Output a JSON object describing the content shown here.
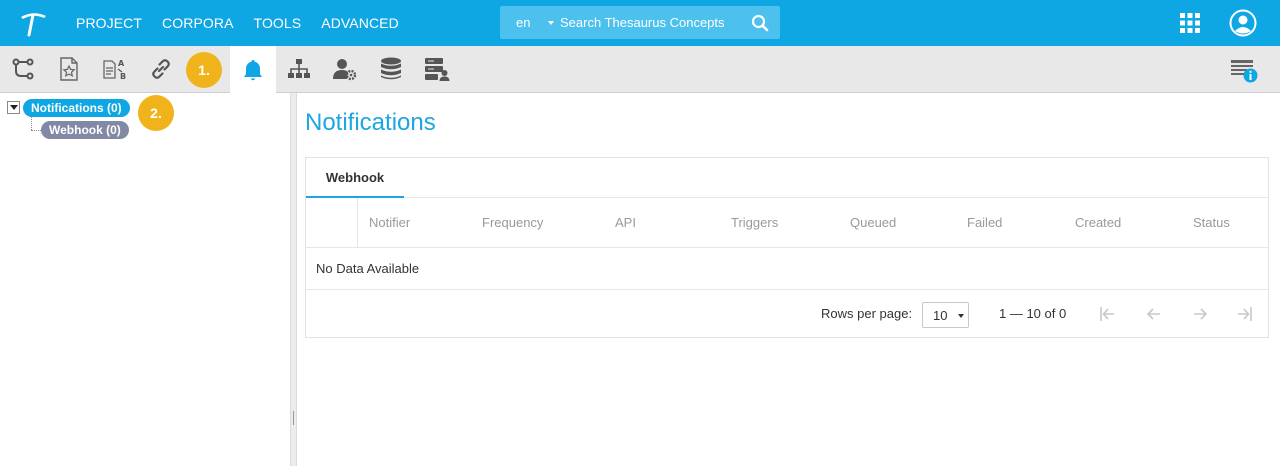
{
  "topbar": {
    "nav": [
      "PROJECT",
      "CORPORA",
      "TOOLS",
      "ADVANCED"
    ],
    "search": {
      "language": "en",
      "placeholder": "Search Thesaurus Concepts"
    },
    "icons": [
      "logo-icon",
      "search-icon",
      "apps-grid-icon",
      "user-avatar-icon"
    ]
  },
  "toolbar": {
    "buttons": [
      "hierarchy-icon",
      "favorite-document-icon",
      "translate-icon",
      "link-icon",
      "notifications-bell-icon",
      "org-chart-icon",
      "user-settings-icon",
      "database-icon",
      "server-user-icon"
    ],
    "active": "notifications-bell-icon",
    "markers": [
      "1.",
      "2."
    ],
    "right_icon": "info-panel-icon"
  },
  "tree": {
    "root": "Notifications (0)",
    "child": "Webhook (0)"
  },
  "main": {
    "title": "Notifications",
    "tab": "Webhook",
    "columns": [
      "Notifier",
      "Frequency",
      "API",
      "Triggers",
      "Queued",
      "Failed",
      "Created",
      "Status"
    ],
    "empty": "No Data Available",
    "pagination": {
      "rows_label": "Rows per page:",
      "rows_value": "10",
      "range": "1 — 10 of 0"
    }
  },
  "colors": {
    "accent": "#0ea7e4",
    "marker": "#f1b31c",
    "child_node": "#8289a4",
    "title": "#1da6e0"
  }
}
